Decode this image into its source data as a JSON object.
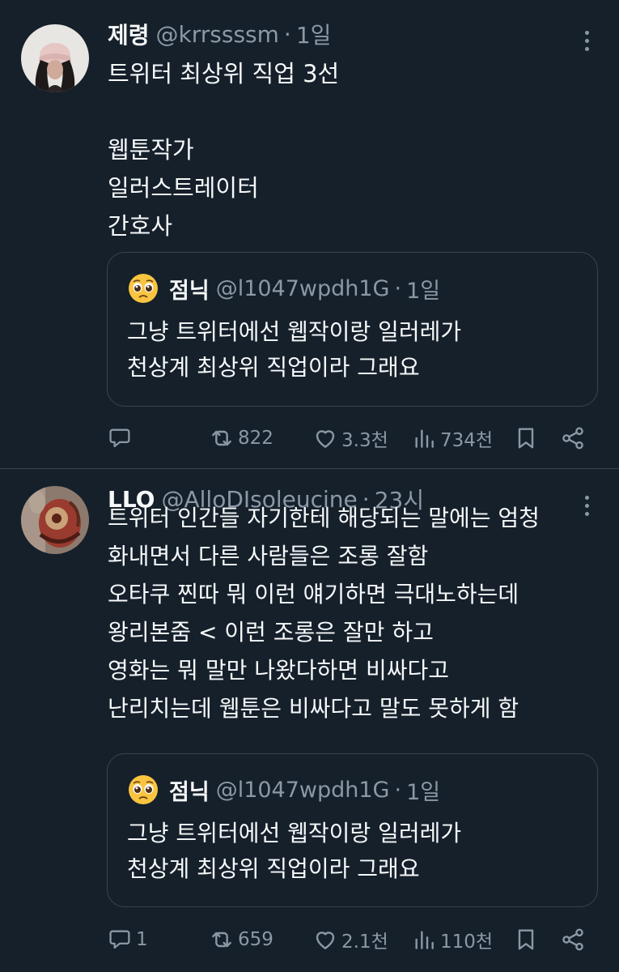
{
  "tweets": [
    {
      "name": "제령",
      "handle": "@krrssssm",
      "time": "1일",
      "dot": "·",
      "text": "트위터 최상위 직업 3선\n\n웹툰작가\n일러스트레이터\n간호사",
      "quote": {
        "name": "점닉",
        "handle": "@l1047wpdh1G",
        "time": "1일",
        "dot": "·",
        "text": "그냥 트위터에선 웹작이랑 일러레가\n천상계 최상위 직업이라 그래요"
      },
      "replies": "",
      "retweets": "822",
      "likes": "3.3천",
      "views": "734천"
    },
    {
      "name": "LLO",
      "handle": "@AlloDIsoleucine",
      "time": "23시",
      "dot": "·",
      "text": "트위터 인간들 자기한테 해당되는 말에는 엄청\n화내면서 다른 사람들은 조롱 잘함\n오타쿠 찐따 뭐 이런 얘기하면 극대노하는데\n왕리본줌 < 이런 조롱은 잘만 하고\n영화는 뭐 말만 나왔다하면 비싸다고\n난리치는데 웹툰은 비싸다고 말도 못하게 함",
      "quote": {
        "name": "점닉",
        "handle": "@l1047wpdh1G",
        "time": "1일",
        "dot": "·",
        "text": "그냥 트위터에선 웹작이랑 일러레가\n천상계 최상위 직업이라 그래요"
      },
      "replies": "1",
      "retweets": "659",
      "likes": "2.1천",
      "views": "110천"
    }
  ],
  "colors": {
    "background": "#15202b",
    "text": "#f7f9f9",
    "secondary": "#8b98a5",
    "border": "#38444d"
  },
  "icons": {
    "reply": "speech-bubble-icon",
    "retweet": "retweet-arrows-icon",
    "like": "heart-icon",
    "views": "bar-chart-icon",
    "bookmark": "bookmark-icon",
    "share": "share-icon",
    "more": "three-dots-vertical-icon",
    "quote_avatar": "pleading-face-emoji"
  }
}
